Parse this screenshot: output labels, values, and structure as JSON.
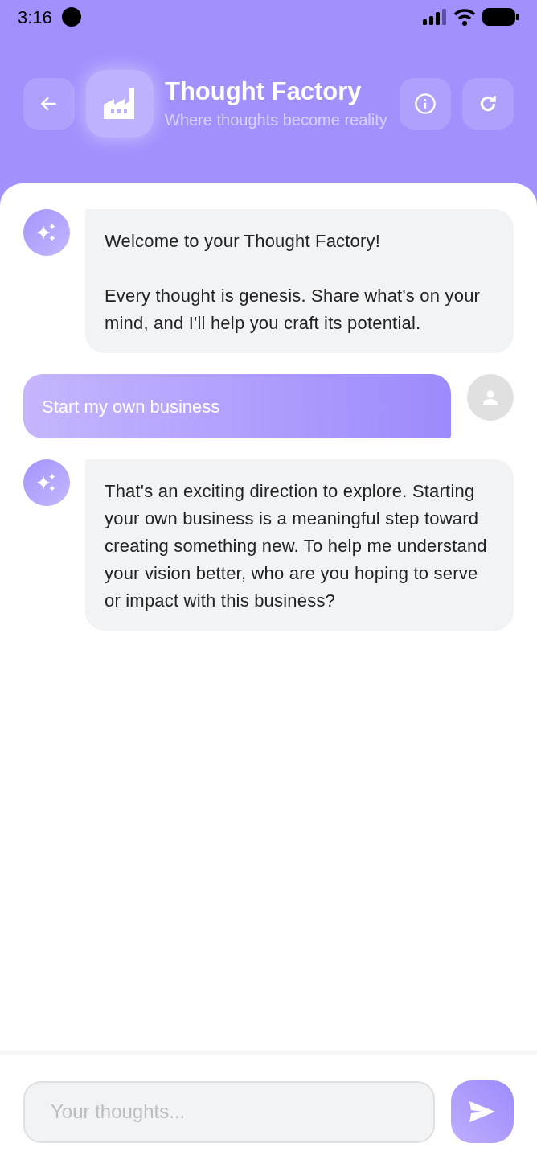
{
  "status_bar": {
    "time": "3:16"
  },
  "header": {
    "title": "Thought Factory",
    "subtitle": "Where thoughts become reality"
  },
  "messages": [
    {
      "kind": "bot",
      "text": "Welcome to your Thought Factory!\n\nEvery thought is genesis. Share what's on your mind, and I'll help you craft its potential."
    },
    {
      "kind": "user",
      "text": "Start my own business"
    },
    {
      "kind": "bot",
      "text": "That's an exciting direction to explore. Starting your own business is a meaningful step toward creating something new. To help me understand your vision better, who are you hoping to serve or impact with this business?"
    }
  ],
  "composer": {
    "placeholder": "Your thoughts..."
  }
}
